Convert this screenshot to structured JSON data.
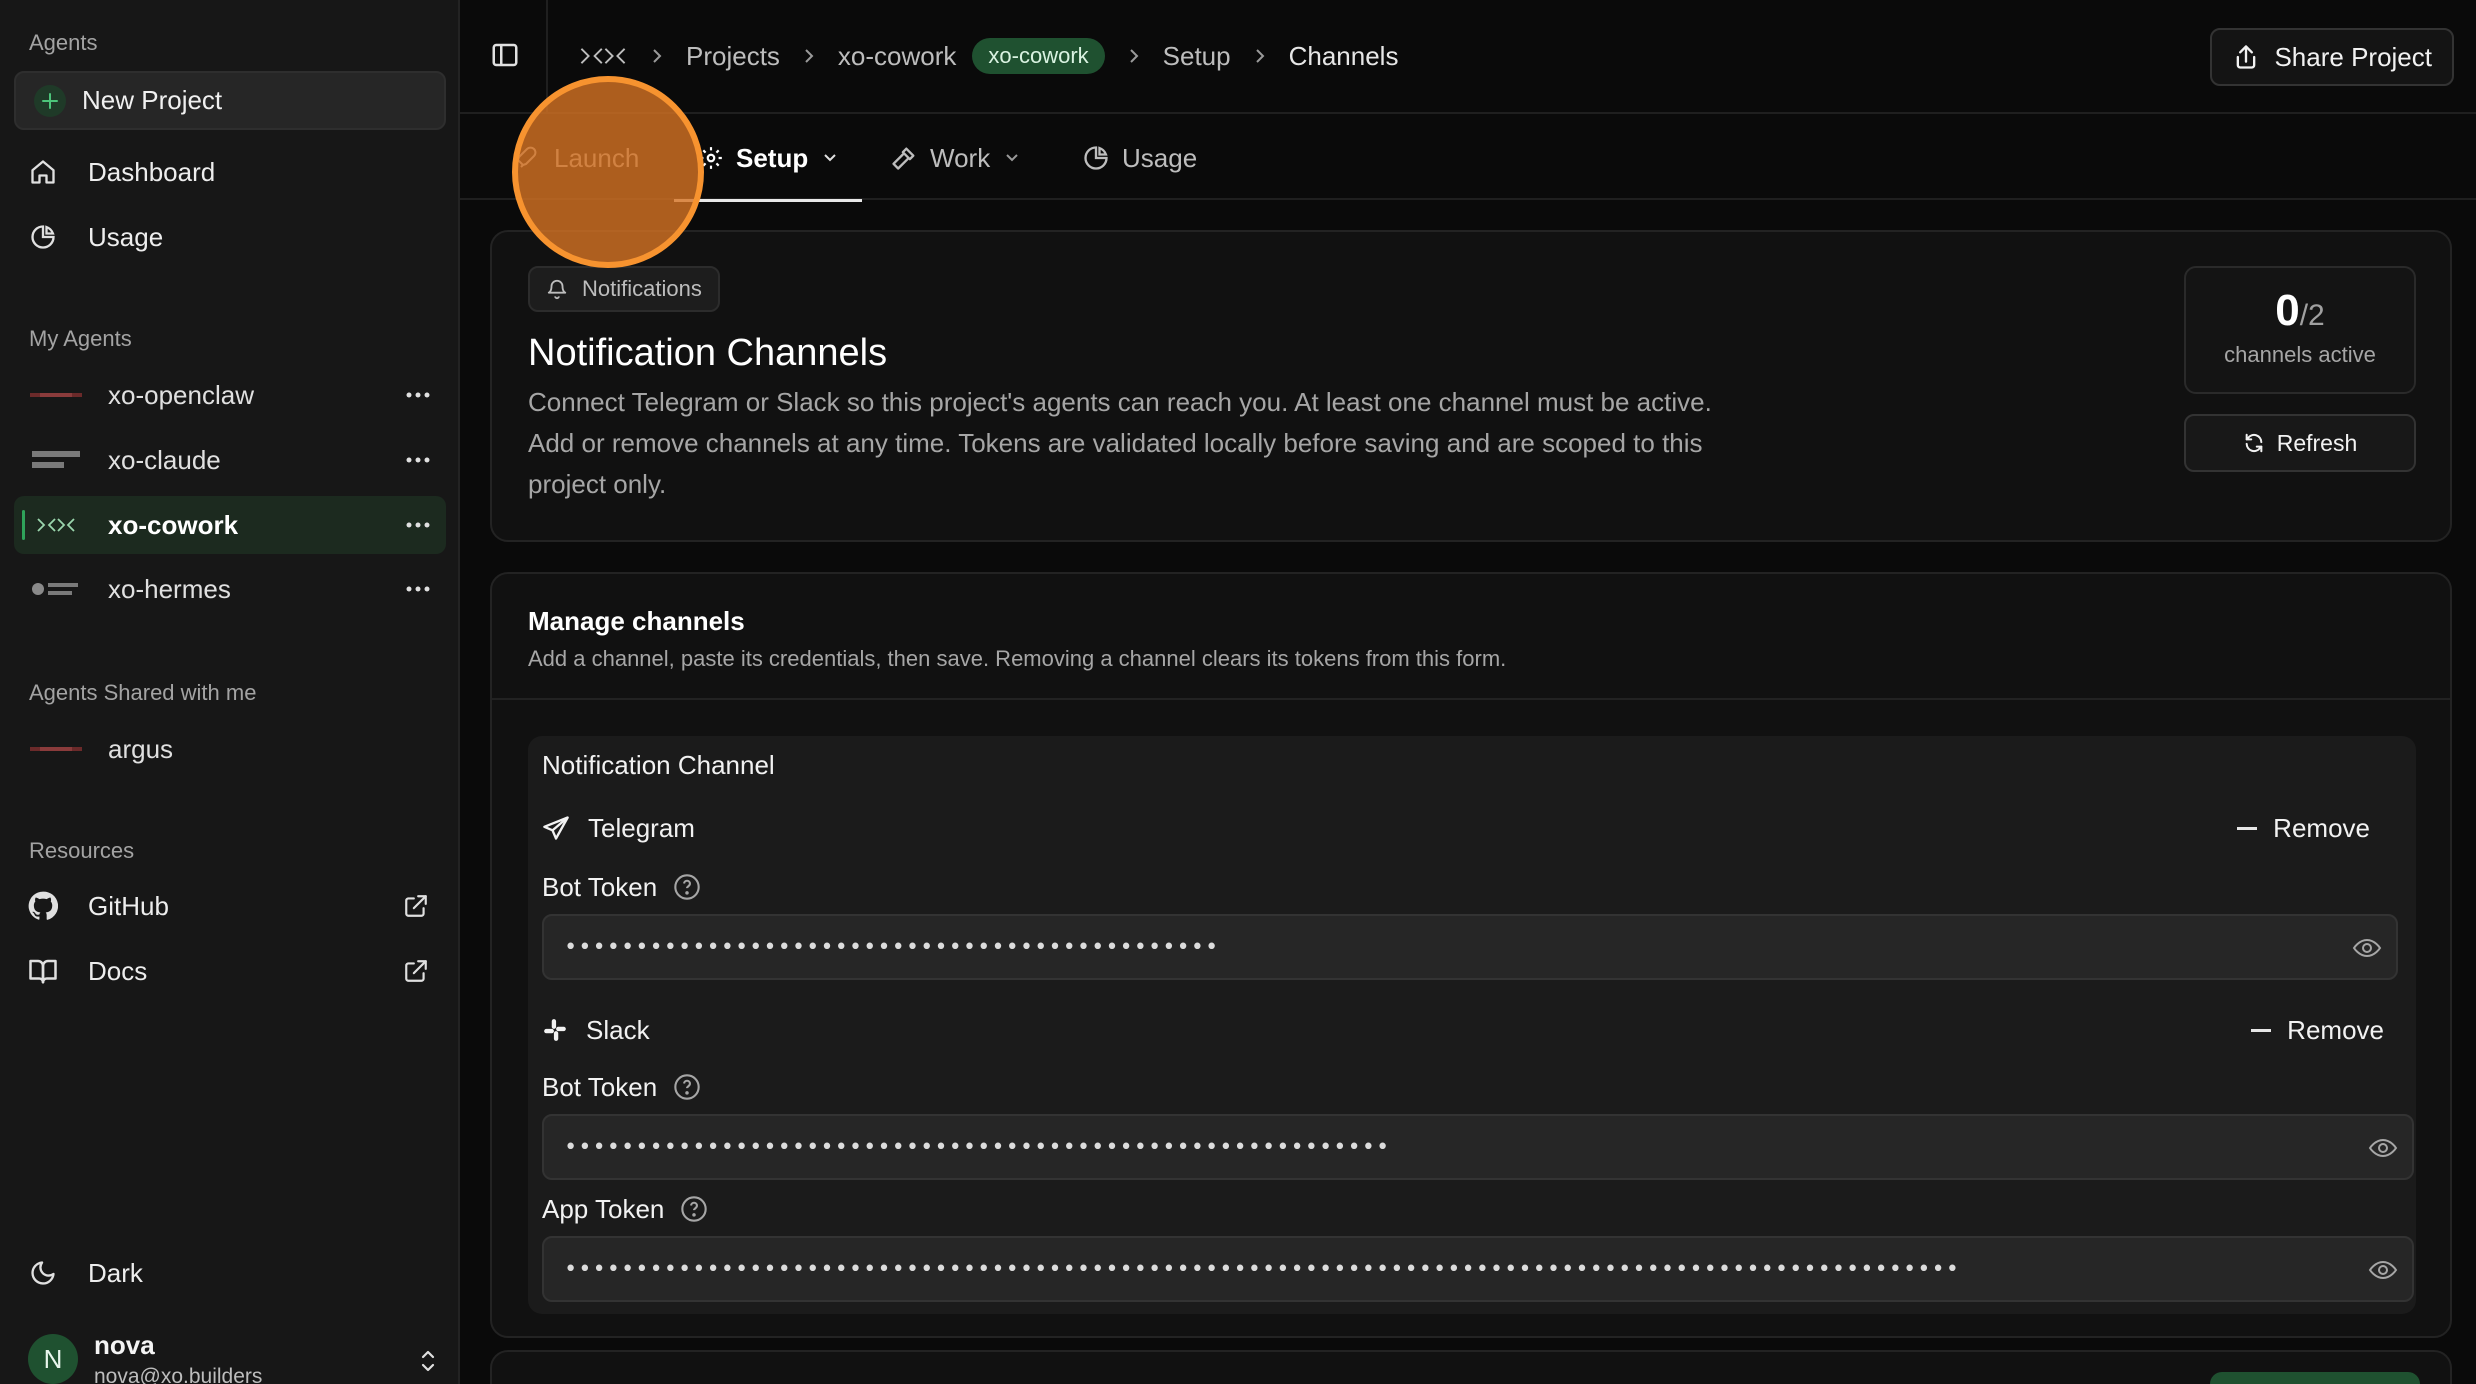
{
  "sidebar": {
    "agents_label": "Agents",
    "new_project": "New Project",
    "nav": [
      {
        "label": "Dashboard",
        "icon": "home-icon"
      },
      {
        "label": "Usage",
        "icon": "pie-chart-icon"
      }
    ],
    "my_agents_label": "My Agents",
    "my_agents": [
      {
        "label": "xo-openclaw",
        "logo": "OPENCLAW"
      },
      {
        "label": "xo-claude",
        "logo": "CLAUDE CODE"
      },
      {
        "label": "xo-cowork",
        "logo": ">«»",
        "active": true
      },
      {
        "label": "xo-hermes",
        "logo": "HERMES AGENT"
      }
    ],
    "shared_label": "Agents Shared with me",
    "shared": [
      {
        "label": "argus",
        "logo": "OPENCLAW"
      }
    ],
    "resources_label": "Resources",
    "resources": [
      {
        "label": "GitHub",
        "icon": "github-icon"
      },
      {
        "label": "Docs",
        "icon": "book-icon"
      }
    ],
    "theme_label": "Dark",
    "user": {
      "initial": "N",
      "name": "nova",
      "email": "nova@xo.builders"
    }
  },
  "topbar": {
    "breadcrumb": {
      "logo": ">«»",
      "projects": "Projects",
      "project": "xo-cowork",
      "project_pill": "xo-cowork",
      "setup": "Setup",
      "current": "Channels"
    },
    "share_label": "Share Project"
  },
  "tabs": [
    {
      "label": "Launch",
      "icon": "rocket-icon"
    },
    {
      "label": "Setup",
      "icon": "gear-icon",
      "active": true
    },
    {
      "label": "Work",
      "icon": "hammer-icon"
    },
    {
      "label": "Usage",
      "icon": "pie-chart-icon"
    }
  ],
  "header_card": {
    "badge": "Notifications",
    "title": "Notification Channels",
    "description": "Connect Telegram or Slack so this project's agents can reach you. At least one channel must be active. Add or remove channels at any time. Tokens are validated locally before saving and are scoped to this project only.",
    "count_active": "0",
    "count_total": "/2",
    "count_label": "channels active",
    "refresh_label": "Refresh"
  },
  "manage": {
    "title": "Manage channels",
    "subtitle": "Add a channel, paste its credentials, then save. Removing a channel clears its tokens from this form.",
    "section_title": "Notification Channel",
    "remove_label": "Remove",
    "telegram": {
      "name": "Telegram",
      "bot_token_label": "Bot Token",
      "bot_token_value": "••••••••••••••••••••••••••••••••••••••••••••••"
    },
    "slack": {
      "name": "Slack",
      "bot_token_label": "Bot Token",
      "bot_token_value": "••••••••••••••••••••••••••••••••••••••••••••••••••••••••••",
      "app_token_label": "App Token",
      "app_token_value": "••••••••••••••••••••••••••••••••••••••••••••••••••••••••••••••••••••••••••••••••••••••••••••••••••"
    }
  },
  "colors": {
    "accent_green": "#1f5130",
    "launch_highlight": "#f7932f",
    "background": "#0a0a0a",
    "sidebar": "#171717"
  }
}
